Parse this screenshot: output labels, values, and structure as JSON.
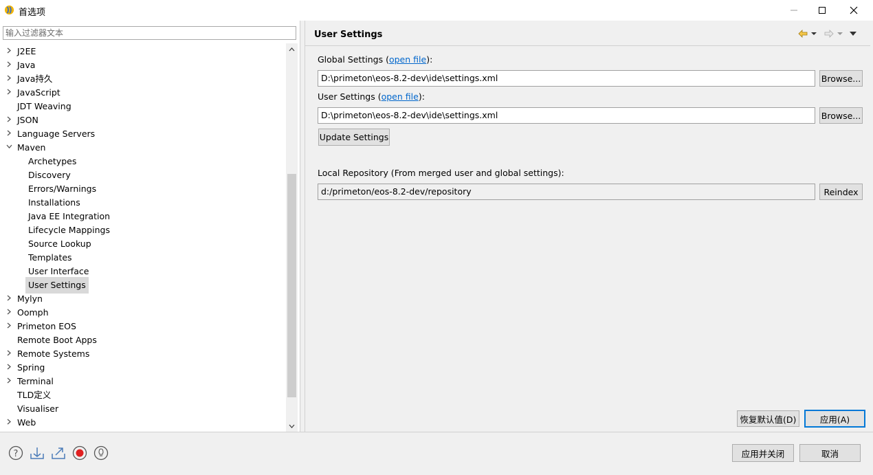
{
  "window": {
    "title": "首选项",
    "icon": "eclipse-app-icon"
  },
  "filter": {
    "placeholder": "输入过滤器文本"
  },
  "tree": {
    "items": [
      {
        "label": "J2EE",
        "depth": 0,
        "expandable": true,
        "expanded": false
      },
      {
        "label": "Java",
        "depth": 0,
        "expandable": true,
        "expanded": false
      },
      {
        "label": "Java持久",
        "depth": 0,
        "expandable": true,
        "expanded": false
      },
      {
        "label": "JavaScript",
        "depth": 0,
        "expandable": true,
        "expanded": false
      },
      {
        "label": "JDT Weaving",
        "depth": 0,
        "expandable": false
      },
      {
        "label": "JSON",
        "depth": 0,
        "expandable": true,
        "expanded": false
      },
      {
        "label": "Language Servers",
        "depth": 0,
        "expandable": true,
        "expanded": false
      },
      {
        "label": "Maven",
        "depth": 0,
        "expandable": true,
        "expanded": true
      },
      {
        "label": "Archetypes",
        "depth": 1
      },
      {
        "label": "Discovery",
        "depth": 1
      },
      {
        "label": "Errors/Warnings",
        "depth": 1
      },
      {
        "label": "Installations",
        "depth": 1
      },
      {
        "label": "Java EE Integration",
        "depth": 1
      },
      {
        "label": "Lifecycle Mappings",
        "depth": 1
      },
      {
        "label": "Source Lookup",
        "depth": 1
      },
      {
        "label": "Templates",
        "depth": 1
      },
      {
        "label": "User Interface",
        "depth": 1
      },
      {
        "label": "User Settings",
        "depth": 1,
        "selected": true
      },
      {
        "label": "Mylyn",
        "depth": 0,
        "expandable": true,
        "expanded": false
      },
      {
        "label": "Oomph",
        "depth": 0,
        "expandable": true,
        "expanded": false
      },
      {
        "label": "Primeton EOS",
        "depth": 0,
        "expandable": true,
        "expanded": false
      },
      {
        "label": "Remote Boot Apps",
        "depth": 0,
        "expandable": false
      },
      {
        "label": "Remote Systems",
        "depth": 0,
        "expandable": true,
        "expanded": false
      },
      {
        "label": "Spring",
        "depth": 0,
        "expandable": true,
        "expanded": false
      },
      {
        "label": "Terminal",
        "depth": 0,
        "expandable": true,
        "expanded": false
      },
      {
        "label": "TLD定义",
        "depth": 0,
        "expandable": false
      },
      {
        "label": "Visualiser",
        "depth": 0,
        "expandable": false
      },
      {
        "label": "Web",
        "depth": 0,
        "expandable": true,
        "expanded": false
      }
    ]
  },
  "page": {
    "title": "User Settings",
    "global": {
      "label_prefix": "Global Settings (",
      "link": "open file",
      "label_suffix": "):",
      "value": "D:\\primeton\\eos-8.2-dev\\ide\\settings.xml",
      "browse": "Browse..."
    },
    "user": {
      "label_prefix": "User Settings (",
      "link": "open file",
      "label_suffix": "):",
      "value": "D:\\primeton\\eos-8.2-dev\\ide\\settings.xml",
      "browse": "Browse..."
    },
    "update_button": "Update Settings",
    "local_repo": {
      "label": "Local Repository (From merged user and global settings):",
      "value": "d:/primeton/eos-8.2-dev/repository",
      "reindex": "Reindex"
    },
    "restore_defaults": "恢复默认值(D)",
    "apply": "应用(A)"
  },
  "footer": {
    "apply_close": "应用并关闭",
    "cancel": "取消",
    "icons": [
      "help-icon",
      "import-icon",
      "export-icon",
      "record-icon",
      "tip-icon"
    ]
  },
  "colors": {
    "link": "#0066cc",
    "selection": "#d9d9d9",
    "default_button_border": "#0078d7"
  }
}
